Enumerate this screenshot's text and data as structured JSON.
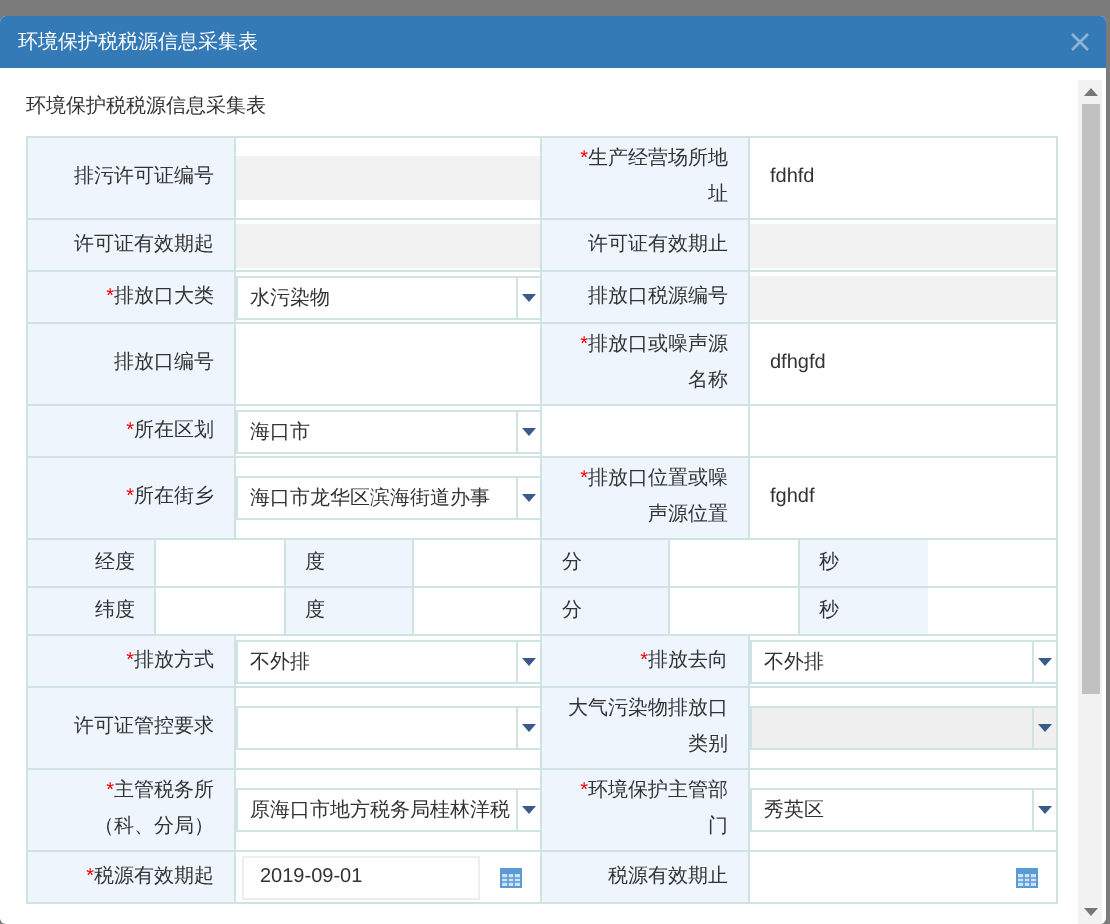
{
  "dialog": {
    "title": "环境保护税税源信息采集表",
    "form_title": "环境保护税税源信息采集表",
    "rows": [
      {
        "kind": "pair",
        "cells": [
          {
            "label": "排污许可证编号",
            "field": {
              "kind": "text",
              "disabled": true
            }
          },
          {
            "mark": "*",
            "label": "生产经营场所地址",
            "field": {
              "kind": "text",
              "disabled": false,
              "value": "fdhfd"
            }
          }
        ]
      },
      {
        "kind": "pair",
        "cells": [
          {
            "label": "许可证有效期起",
            "field": {
              "kind": "text",
              "disabled": true
            }
          },
          {
            "label": "许可证有效期止",
            "field": {
              "kind": "text",
              "disabled": true
            }
          }
        ]
      },
      {
        "kind": "pair",
        "cells": [
          {
            "mark": "*",
            "label": "排放口大类",
            "field": {
              "kind": "select",
              "disabled": false,
              "value": "水污染物"
            }
          },
          {
            "label": "排放口税源编号",
            "field": {
              "kind": "text",
              "disabled": true
            }
          }
        ]
      },
      {
        "kind": "pair",
        "cells": [
          {
            "label": "排放口编号",
            "field": {
              "kind": "text"
            }
          },
          {
            "mark": "*",
            "label": "排放口或噪声源名称",
            "field": {
              "kind": "text",
              "disabled": false,
              "value": "dfhgfd"
            }
          }
        ]
      },
      {
        "kind": "pair",
        "cells": [
          {
            "mark": "*",
            "label": "所在区划",
            "field": {
              "kind": "select",
              "disabled": false,
              "value": "海口市"
            }
          },
          {
            "field": {
              "kind": "text"
            }
          }
        ]
      },
      {
        "kind": "pair",
        "cells": [
          {
            "mark": "*",
            "label": "所在街乡",
            "field": {
              "kind": "select",
              "disabled": false,
              "value": "海口市龙华区滨海街道办事"
            }
          },
          {
            "mark": "*",
            "label": "排放口位置或噪声源位置",
            "field": {
              "kind": "text",
              "disabled": false,
              "value": "fghdf"
            }
          }
        ]
      },
      {
        "kind": "coords",
        "label": "经度",
        "units": [
          "度",
          "分",
          "秒"
        ]
      },
      {
        "kind": "coords",
        "label": "纬度",
        "units": [
          "度",
          "分",
          "秒"
        ]
      },
      {
        "kind": "pair",
        "cells": [
          {
            "mark": "*",
            "label": "排放方式",
            "field": {
              "kind": "select",
              "disabled": false,
              "value": "不外排"
            }
          },
          {
            "mark": "*",
            "label": "排放去向",
            "field": {
              "kind": "select",
              "disabled": false,
              "value": "不外排"
            }
          }
        ]
      },
      {
        "kind": "pair",
        "cells": [
          {
            "label": "许可证管控要求",
            "field": {
              "kind": "select",
              "disabled": false
            }
          },
          {
            "label": "大气污染物排放口类别",
            "field": {
              "kind": "select",
              "disabled": true
            }
          }
        ]
      },
      {
        "kind": "pair",
        "cells": [
          {
            "mark": "*",
            "label": "主管税务所（科、分局）",
            "field": {
              "kind": "select",
              "disabled": false,
              "value": "原海口市地方税务局桂林洋税"
            }
          },
          {
            "mark": "*",
            "label": "环境保护主管部门",
            "field": {
              "kind": "select",
              "disabled": false,
              "value": "秀英区"
            }
          }
        ]
      },
      {
        "kind": "pair",
        "cells": [
          {
            "mark": "*",
            "label": "税源有效期起",
            "field": {
              "kind": "date",
              "disabled": false,
              "value": "2019-09-01"
            }
          },
          {
            "label": "税源有效期止",
            "field": {
              "kind": "date"
            }
          }
        ]
      }
    ]
  }
}
